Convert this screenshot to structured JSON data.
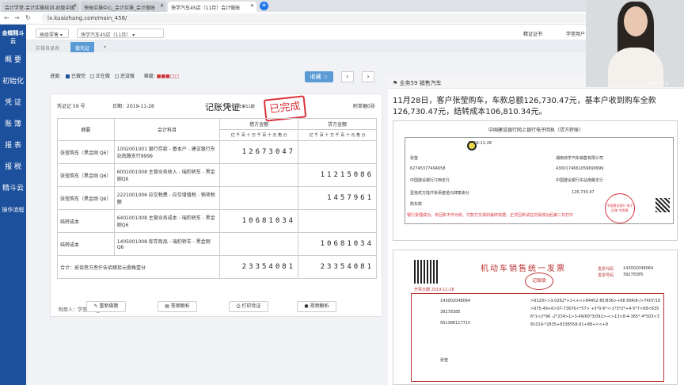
{
  "browser": {
    "tabs": [
      "会计学堂-会计实操培训-初级中级",
      "快账实操中心_会计实操_会计做账",
      "快学汽车4S店（11月）会计做账"
    ],
    "url": "lx.kuaizhang.com/main_458/"
  },
  "sidebar": {
    "logo": "金蝶精斗云",
    "items": [
      "概 要",
      "初始化",
      "凭 证",
      "账 簿",
      "报 表",
      "报 税",
      "精斗云",
      "操作流程"
    ]
  },
  "topnav": {
    "dropdown1": "高级零售",
    "dropdown2": "快学汽车4S店（11月）",
    "right1": "精证证书",
    "right2": "学堂用户_"
  },
  "subtabs": {
    "t1": "实操目录表",
    "t2": "做凭证"
  },
  "progress": {
    "label": "进度:",
    "done": "已做完",
    "doing": "正在做",
    "undone": "还没做",
    "difficulty": "难度:"
  },
  "buttons": {
    "collect": "收藏 ☆",
    "reset": "重新做题",
    "answer": "答案解析",
    "print": "打印凭证",
    "video": "视频解析"
  },
  "voucher": {
    "number": "凭证记 59 号",
    "date": "日期：2019-11-28",
    "title": "记账凭证",
    "period": "2019 年第11期",
    "attachments": "附单据0张",
    "stamp": "已完成",
    "headers": {
      "summary": "摘要",
      "account": "会计科目",
      "debit": "借方金额",
      "credit": "贷方金额",
      "units": [
        "亿",
        "千",
        "百",
        "十",
        "万",
        "千",
        "百",
        "十",
        "元",
        "角",
        "分"
      ]
    },
    "rows": [
      {
        "summary": "张莹购车（黑金刚 Q6）",
        "account": "1002001001 银行存款 - 基本户 - 建设银行东站南路支行9999",
        "debit": "12673047",
        "credit": ""
      },
      {
        "summary": "张莹购车（黑金刚 Q6）",
        "account": "6001001008 主营业务收入 - 瑞豹轿车 - 黑金刚Q6",
        "debit": "",
        "credit": "11215086"
      },
      {
        "summary": "张莹购车（黑金刚 Q6）",
        "account": "2221001006 应交税费 - 应交增值税 - 销项税额",
        "debit": "",
        "credit": "1457961"
      },
      {
        "summary": "结转成本",
        "account": "6401001008 主营业务成本 - 瑞豹轿车 - 黑金刚Q6",
        "debit": "10681034",
        "credit": ""
      },
      {
        "summary": "结转成本",
        "account": "1405001008 库存商品 - 瑞豹轿车 - 黑金刚 Q6",
        "debit": "",
        "credit": "10681034"
      }
    ],
    "total_label": "合计：贰佰叁万叁仟伍佰肆拾元捌角壹分",
    "total_debit": "23354081",
    "total_credit": "23354081",
    "maker": "制单人：学堂用户_ph872910"
  },
  "right": {
    "title": "业务59 销售汽车",
    "question": "11月28日，客户张莹购车，车款总额126,730.47元，基本户收到购车全款126,730.47元，结转成本106,810.34元。",
    "bank": {
      "bank_name": "中国建设银行网上银行电子回执（贷方转账）",
      "date": "2019-11-28",
      "pay_name": "张莹",
      "pay_acct": "62745377494658",
      "pay_bank": "中国建设银行江西支行",
      "recv_name": "湖南快学汽车销售有限公司",
      "recv_acct": "4300174661059699999",
      "recv_bank": "中国建设银行东站南路支行",
      "amount_cn": "壹拾贰万陆仟柒佰叁拾元肆角柒分",
      "amount": "126,730.47",
      "purpose": "购车款",
      "note": "银行受理成功，本回执不作为收、付款方交易的最终依据，正式回单请在交易成功后第二日打印",
      "stamp": "中国建设银行 电子回单 专用章"
    },
    "invoice": {
      "title": "机动车销售统一发票",
      "code_label": "发票代码",
      "code": "143002048064",
      "num_label": "发票号码",
      "num": "39278385",
      "date": "开票日期 2019-11-28",
      "machine_code": "143002048064",
      "machine_num": "39278385",
      "tax_code": "561388117715",
      "cipher": ">6129>>3-0262*+1<+<+84452-85/836>+98 894/8-/>7407/16>675-49+6>07-73676<*57> +5*0-6*<-1*3*2*+4-5*7<68<6356*1<//*96 -2*234>1>3-49/60*3/092>-<>13<8-4-365* 4*503<381019-*2835+8338558-91+88+<<+8",
      "buyer": "张莹",
      "stamp_text": "记账联"
    }
  },
  "webcam": {
    "label": "教师口才计"
  }
}
